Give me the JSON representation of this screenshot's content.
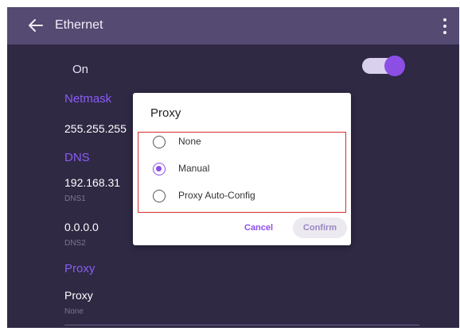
{
  "appbar": {
    "title": "Ethernet",
    "back_icon": "arrow-left-icon",
    "more_icon": "more-vertical-icon"
  },
  "toggle_row": {
    "label": "On",
    "state": "on"
  },
  "settings": {
    "netmask": {
      "header": "Netmask",
      "value": "255.255.255"
    },
    "dns": {
      "header": "DNS",
      "dns1_value": "192.168.31",
      "dns1_label": "DNS1",
      "dns2_value": "0.0.0.0",
      "dns2_label": "DNS2"
    },
    "proxy": {
      "header": "Proxy",
      "title": "Proxy",
      "subtitle": "None"
    }
  },
  "dialog": {
    "title": "Proxy",
    "options": [
      {
        "label": "None",
        "selected": false
      },
      {
        "label": "Manual",
        "selected": true
      },
      {
        "label": "Proxy Auto-Config",
        "selected": false
      }
    ],
    "cancel_label": "Cancel",
    "confirm_label": "Confirm"
  },
  "colors": {
    "accent": "#8d4ee6",
    "appbar": "#544a72",
    "background": "#2f2944",
    "highlight_border": "#d32f2f"
  }
}
